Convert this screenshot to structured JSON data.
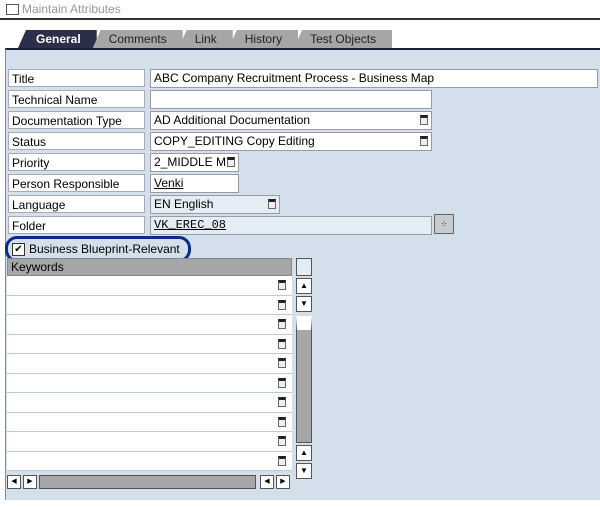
{
  "window": {
    "title": "Maintain Attributes"
  },
  "tabs": [
    {
      "label": "General"
    },
    {
      "label": "Comments"
    },
    {
      "label": "Link"
    },
    {
      "label": "History"
    },
    {
      "label": "Test Objects"
    }
  ],
  "fields": [
    {
      "label": "Title",
      "value": "ABC Company Recruitment Process - Business Map"
    },
    {
      "label": "Technical Name",
      "value": ""
    },
    {
      "label": "Documentation Type",
      "value": "AD Additional Documentation"
    },
    {
      "label": "Status",
      "value": "COPY_EDITING Copy Editing"
    },
    {
      "label": "Priority",
      "value": "2_MIDDLE M"
    },
    {
      "label": "Person Responsible",
      "value": "Venki"
    },
    {
      "label": "Language",
      "value": "EN English"
    },
    {
      "label": "Folder",
      "value": "VK_EREC_08"
    }
  ],
  "checkbox": {
    "label": "Business Blueprint-Relevant",
    "checked": true
  },
  "keywords": {
    "header": "Keywords",
    "rows": [
      "",
      "",
      "",
      "",
      "",
      "",
      "",
      "",
      "",
      ""
    ]
  }
}
